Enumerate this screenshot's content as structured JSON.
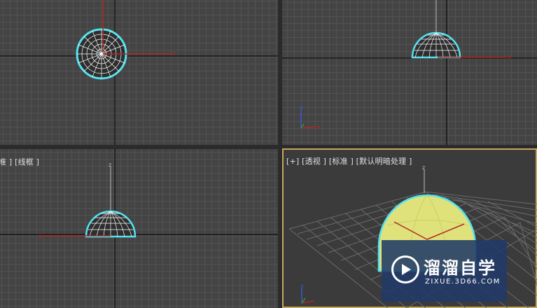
{
  "viewports": {
    "top": {
      "label": ""
    },
    "front": {
      "label": ""
    },
    "left": {
      "label": "准 ] [线框 ]"
    },
    "perspective": {
      "label": "[+] [透视 ] [标准 ] [默认明暗处理 ]"
    }
  },
  "axis_labels": {
    "x": "x",
    "y": "y",
    "z": "z"
  },
  "watermark": {
    "name": "溜溜自学",
    "url": "ZIXUE.3D66.COM"
  },
  "colors": {
    "grid_bg": "#444444",
    "selection": "#54e3f0",
    "axis_red": "#b32727",
    "axis_green": "#2ca02c",
    "axis_blue": "#3a5ad0",
    "sphere_yellow": "#e6ea82",
    "active_border": "#c7a85a",
    "watermark_bg": "#213a68"
  },
  "icons": [
    "play-logo-icon",
    "gizmo-icon"
  ]
}
